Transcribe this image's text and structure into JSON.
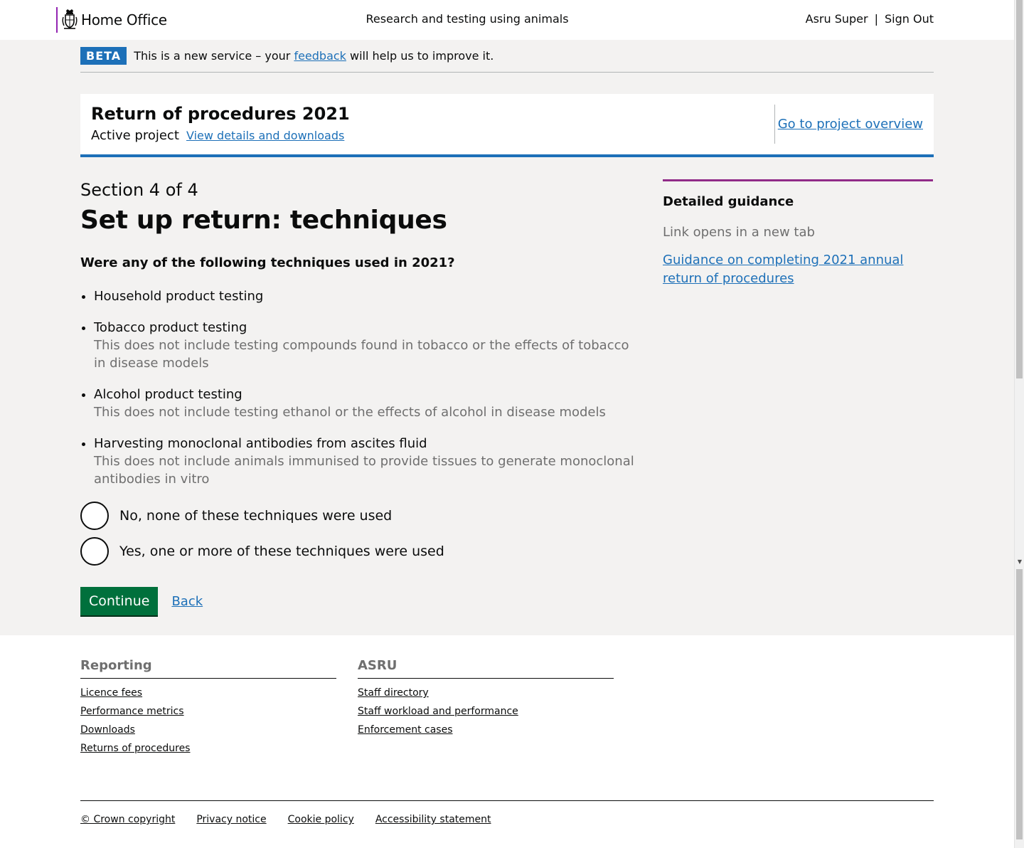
{
  "header": {
    "logo_text": "Home Office",
    "service_name": "Research and testing using animals",
    "user_name": "Asru Super",
    "separator": "|",
    "sign_out": "Sign Out"
  },
  "beta": {
    "tag": "BETA",
    "text_before": "This is a new service – your ",
    "feedback_link": "feedback",
    "text_after": " will help us to improve it."
  },
  "project": {
    "title": "Return of procedures 2021",
    "status": "Active project",
    "details_link": "View details and downloads",
    "overview_link": "Go to project overview"
  },
  "main": {
    "caption": "Section 4 of 4",
    "heading": "Set up return: techniques",
    "question": "Were any of the following techniques used in 2021?",
    "techniques": [
      {
        "label": "Household product testing",
        "hint": ""
      },
      {
        "label": "Tobacco product testing",
        "hint": "This does not include testing compounds found in tobacco or the effects of tobacco in disease models"
      },
      {
        "label": "Alcohol product testing",
        "hint": "This does not include testing ethanol or the effects of alcohol in disease models"
      },
      {
        "label": "Harvesting monoclonal antibodies from ascites fluid",
        "hint": "This does not include animals immunised to provide tissues to generate monoclonal antibodies in vitro"
      }
    ],
    "options": [
      {
        "label": "No, none of these techniques were used",
        "selected": false
      },
      {
        "label": "Yes, one or more of these techniques were used",
        "selected": false
      }
    ],
    "continue_label": "Continue",
    "back_label": "Back"
  },
  "sidebar": {
    "title": "Detailed guidance",
    "hint": "Link opens in a new tab",
    "link": "Guidance on completing 2021 annual return of procedures"
  },
  "footer": {
    "reporting": {
      "title": "Reporting",
      "links": [
        "Licence fees",
        "Performance metrics",
        "Downloads",
        "Returns of procedures"
      ]
    },
    "asru": {
      "title": "ASRU",
      "links": [
        "Staff directory",
        "Staff workload and performance",
        "Enforcement cases"
      ]
    },
    "meta_links": [
      "© Crown copyright",
      "Privacy notice",
      "Cookie policy",
      "Accessibility statement"
    ]
  },
  "colors": {
    "link": "#1d70b8",
    "button": "#00703c",
    "beta_tag": "#1d70b8",
    "guidance_accent": "#912b88",
    "logo_rule": "#9325b2"
  },
  "icons": [
    "royal-crest-icon",
    "radio-icon"
  ]
}
